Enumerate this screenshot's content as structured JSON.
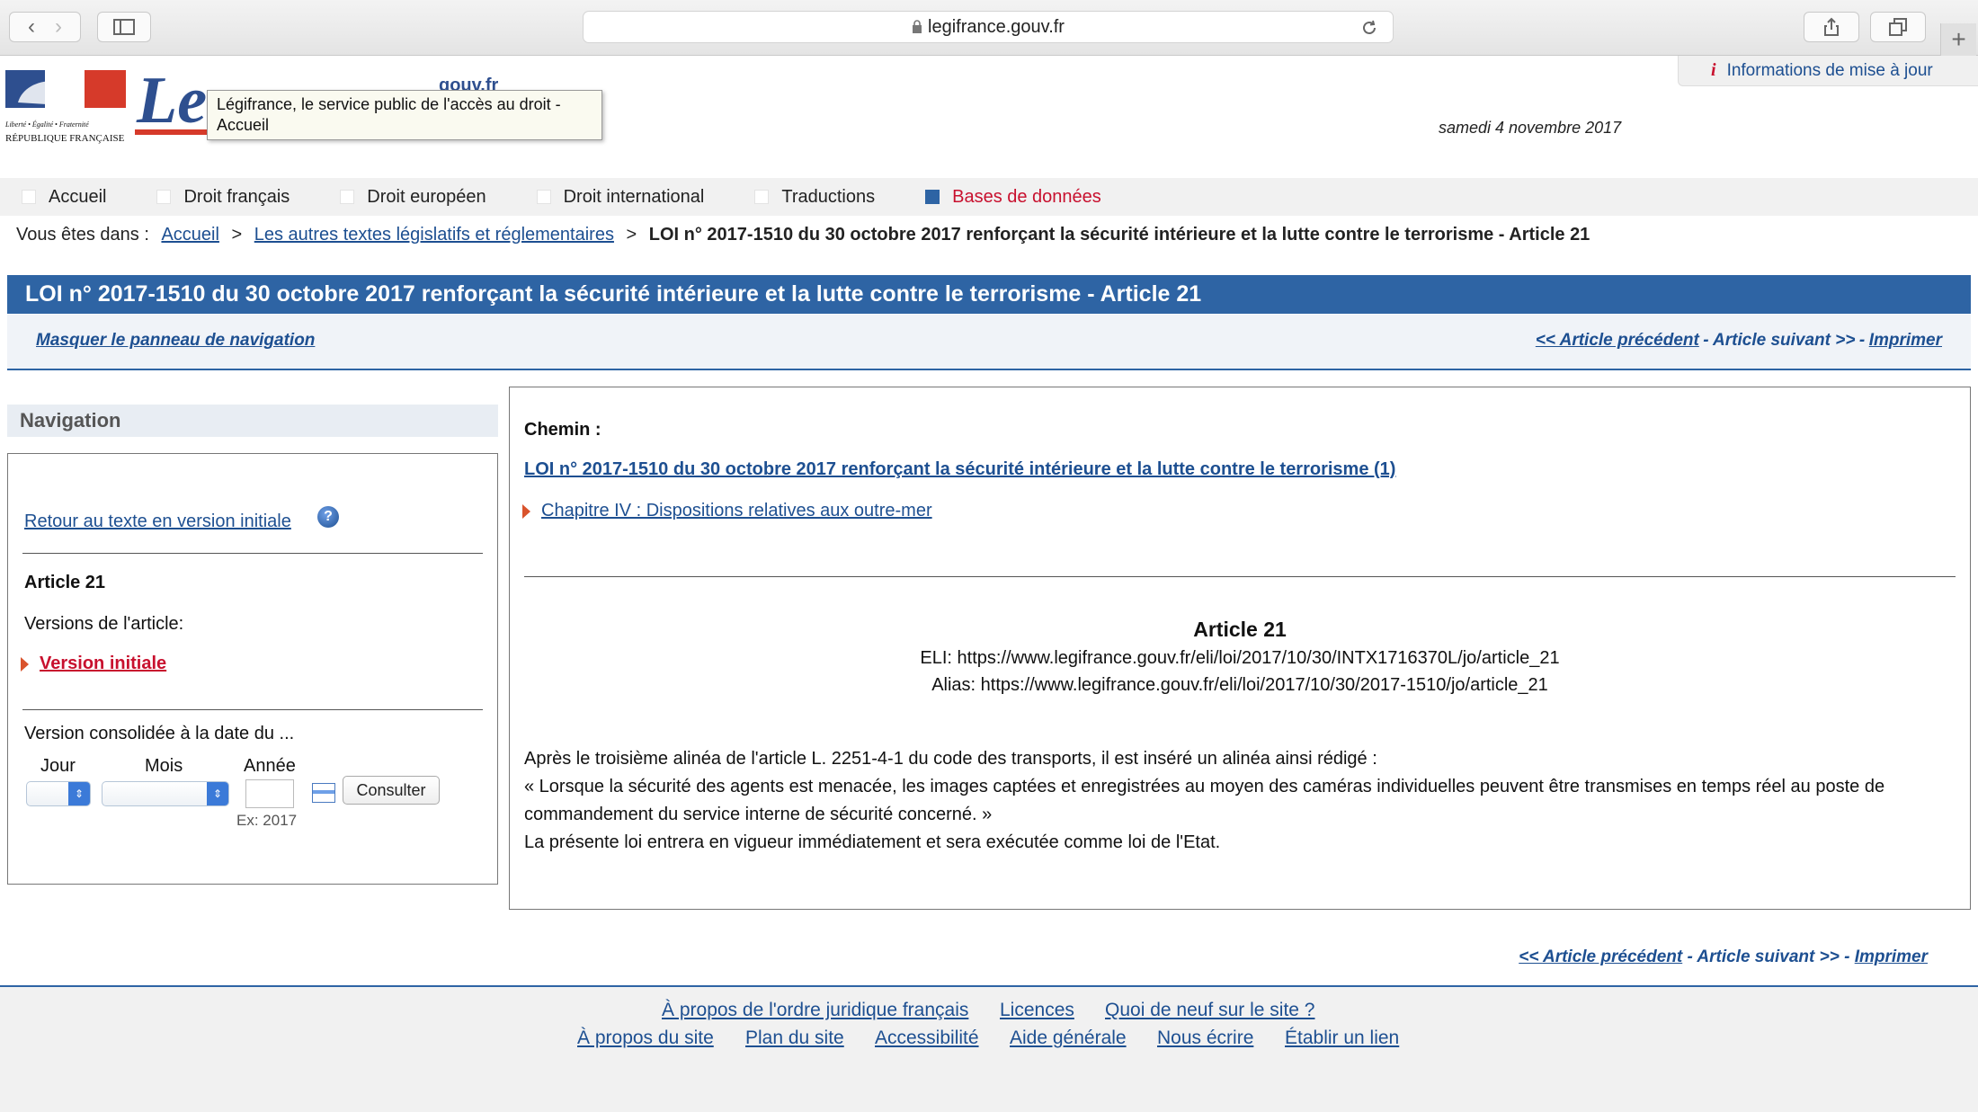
{
  "browser": {
    "url": "legifrance.gouv.fr"
  },
  "header": {
    "republique_motto": "Liberté • Égalité • Fraternité",
    "republique_name": "RÉPUBLIQUE FRANÇAISE",
    "logo_text": "Le",
    "logo_suffix": "gouv.fr",
    "tooltip": "Légifrance, le service public de l'accès au droit - Accueil",
    "date": "samedi 4 novembre 2017",
    "infos_link": "Informations de mise à jour"
  },
  "nav": {
    "items": [
      {
        "label": "Accueil"
      },
      {
        "label": "Droit français"
      },
      {
        "label": "Droit européen"
      },
      {
        "label": "Droit international"
      },
      {
        "label": "Traductions"
      },
      {
        "label": "Bases de données"
      }
    ]
  },
  "breadcrumb": {
    "prefix": "Vous êtes dans :",
    "sep": ">",
    "items": [
      "Accueil",
      "Les autres textes législatifs et réglementaires"
    ],
    "current": "LOI n° 2017-1510 du 30 octobre 2017 renforçant la sécurité intérieure et la lutte contre le terrorisme - Article 21"
  },
  "page_title": "LOI n° 2017-1510 du 30 octobre 2017 renforçant la sécurité intérieure et la lutte contre le terrorisme - Article 21",
  "toolbar": {
    "masquer": "Masquer le panneau de navigation",
    "prev": "<< Article précédent",
    "sep1": "-",
    "next": "Article suivant >>",
    "sep2": "-",
    "print": "Imprimer"
  },
  "sidebar": {
    "heading": "Navigation",
    "retour": "Retour au texte en version initiale",
    "article": "Article 21",
    "versions_label": "Versions de l'article:",
    "version_initiale": "Version initiale",
    "consolidee_label": "Version consolidée à la date du ...",
    "jour": "Jour",
    "mois": "Mois",
    "annee": "Année",
    "annee_value": "",
    "example": "Ex: 2017",
    "consulter": "Consulter"
  },
  "content": {
    "chemin_label": "Chemin :",
    "chemin_loi": "LOI n° 2017-1510 du 30 octobre 2017 renforçant la sécurité intérieure et la lutte contre le terrorisme (1)",
    "chapitre": "Chapitre IV : Dispositions relatives aux outre-mer",
    "article_title": "Article 21",
    "eli": "ELI: https://www.legifrance.gouv.fr/eli/loi/2017/10/30/INTX1716370L/jo/article_21",
    "alias": "Alias: https://www.legifrance.gouv.fr/eli/loi/2017/10/30/2017-1510/jo/article_21",
    "para1": "Après le troisième alinéa de l'article L. 2251-4-1 du code des transports, il est inséré un alinéa ainsi rédigé :",
    "para2": "« Lorsque la sécurité des agents est menacée, les images captées et enregistrées au moyen des caméras individuelles peuvent être transmises en temps réel au poste de commandement du service interne de sécurité concerné. »",
    "para3": "La présente loi entrera en vigueur immédiatement et sera exécutée comme loi de l'Etat."
  },
  "footer": {
    "row1": [
      "À propos de l'ordre juridique français",
      "Licences",
      "Quoi de neuf sur le site ?"
    ],
    "row2": [
      "À propos du site",
      "Plan du site",
      "Accessibilité",
      "Aide générale",
      "Nous écrire",
      "Établir un lien"
    ]
  },
  "colors": {
    "accent": "#2e64a4",
    "active": "#c8102e",
    "link": "#1d4f91"
  }
}
